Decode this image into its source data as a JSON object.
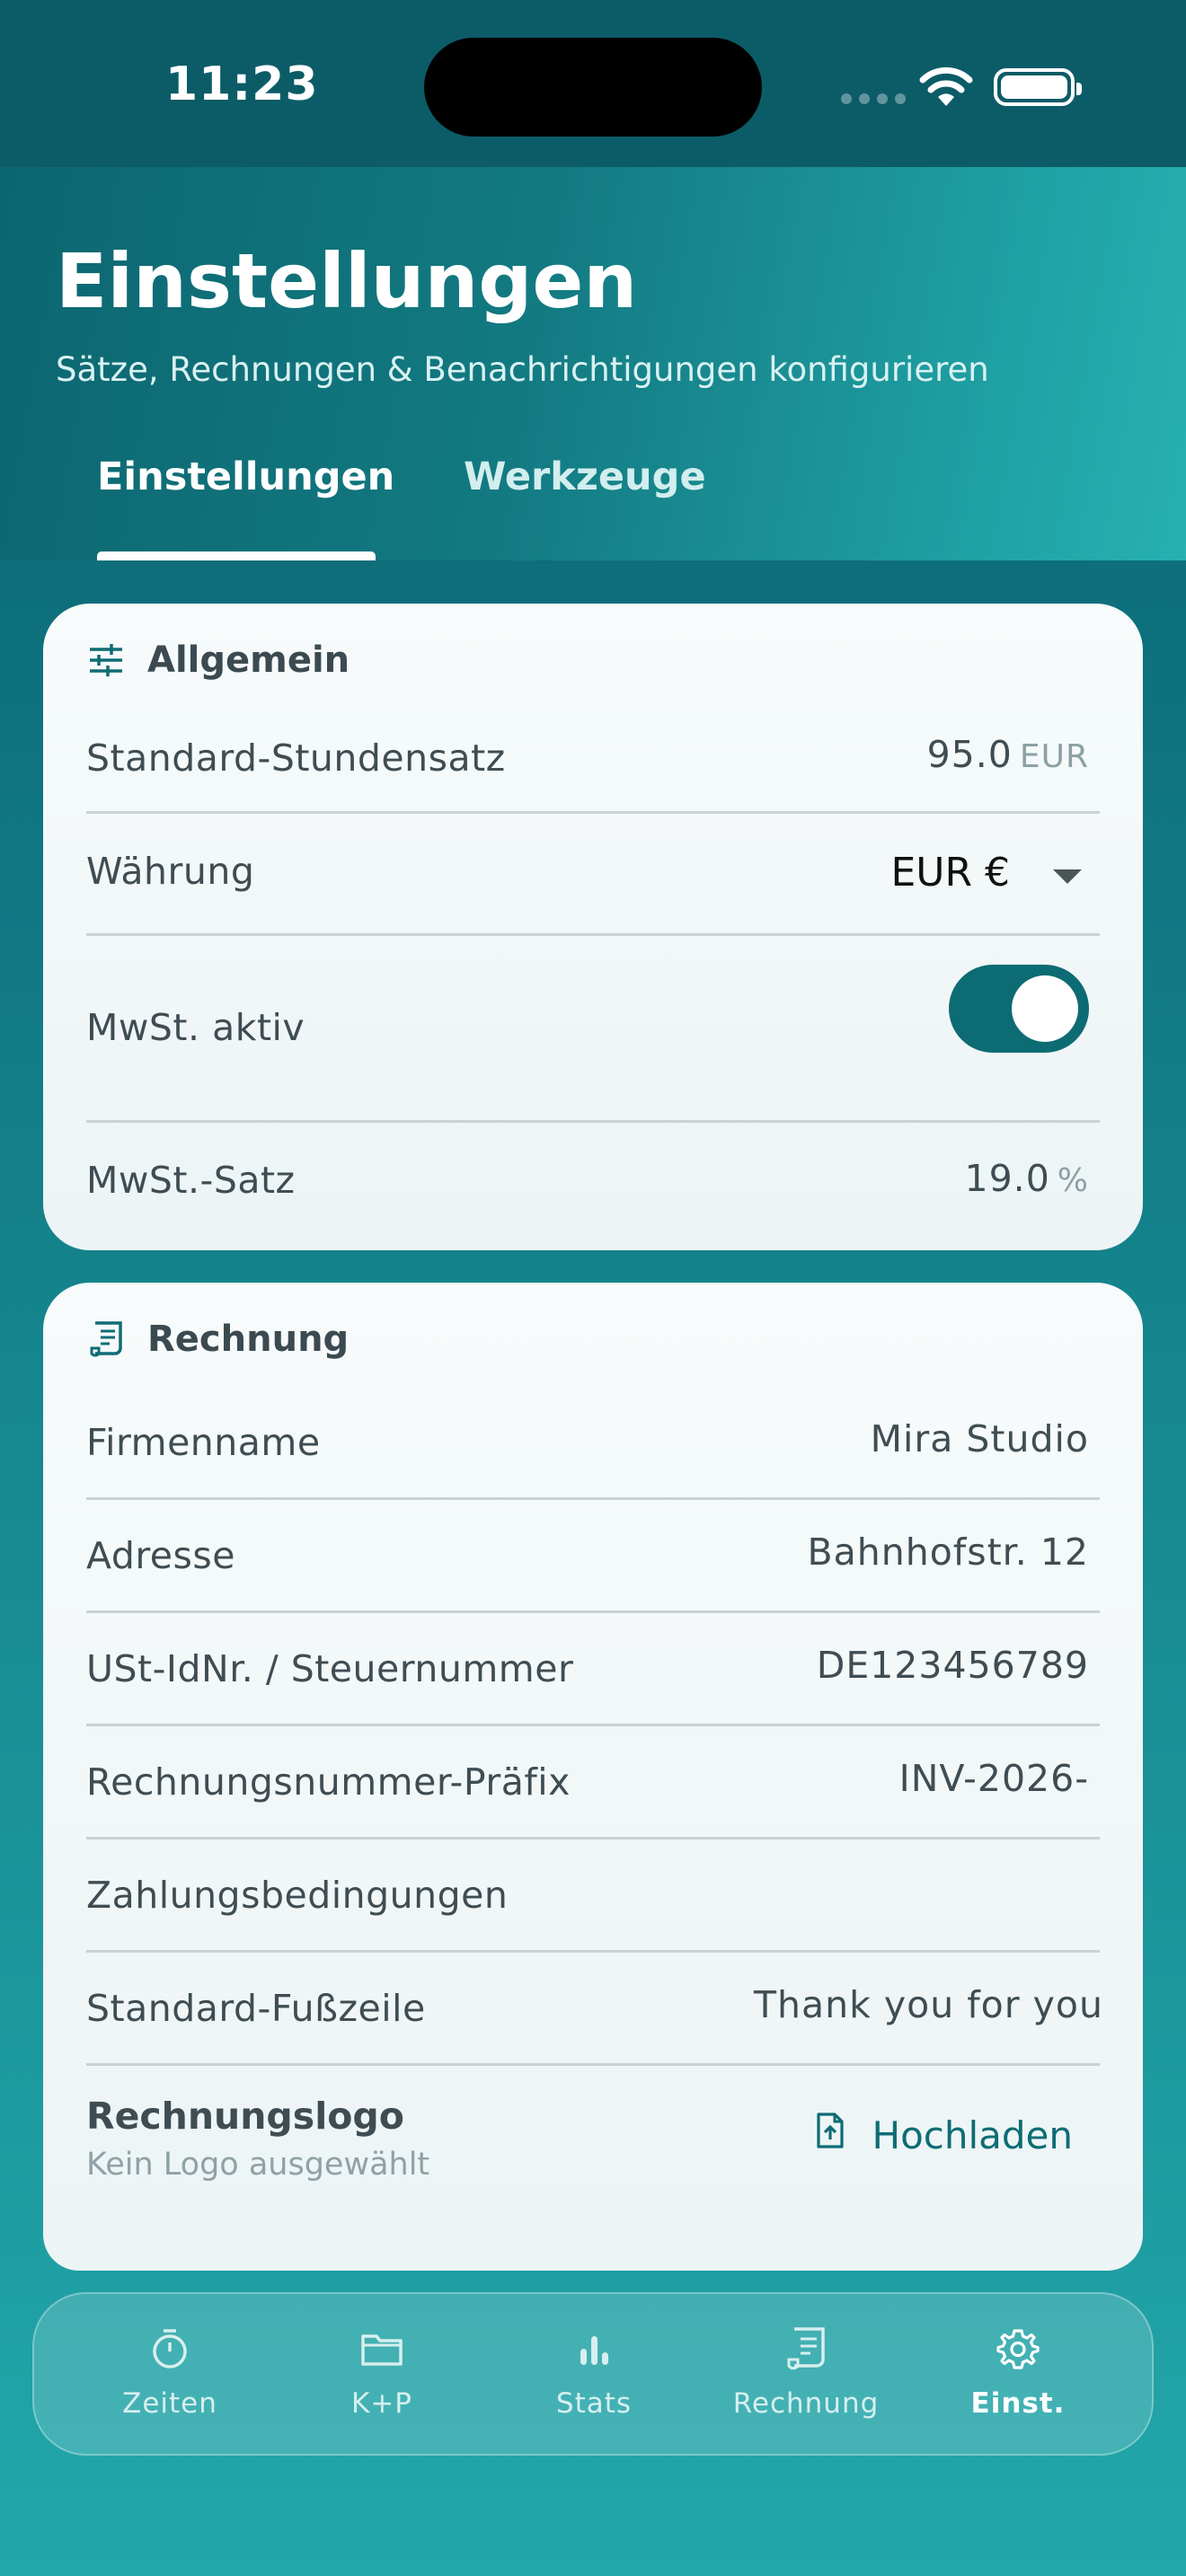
{
  "status_bar": {
    "time": "11:23",
    "icons": [
      "signal-icon",
      "wifi-icon",
      "battery-icon"
    ]
  },
  "header": {
    "title": "Einstellungen",
    "subtitle": "Sätze, Rechnungen & Benachrichtigungen konfigurieren",
    "tabs": [
      {
        "label": "Einstellungen",
        "active": true
      },
      {
        "label": "Werkzeuge",
        "active": false
      }
    ]
  },
  "general": {
    "title": "Allgemein",
    "icon": "sliders-icon",
    "hourly_rate": {
      "label": "Standard-Stundensatz",
      "value": "95.0",
      "unit": "EUR"
    },
    "currency": {
      "label": "Währung",
      "value": "EUR €"
    },
    "vat_active": {
      "label": "MwSt. aktiv",
      "on": true
    },
    "vat_rate": {
      "label": "MwSt.-Satz",
      "value": "19.0",
      "unit": "%"
    }
  },
  "invoice": {
    "title": "Rechnung",
    "icon": "receipt-icon",
    "rows": [
      {
        "label": "Firmenname",
        "value": "Mira Studio"
      },
      {
        "label": "Adresse",
        "value": "Bahnhofstr. 12"
      },
      {
        "label": "USt-IdNr. / Steuernummer",
        "value": "DE123456789"
      },
      {
        "label": "Rechnungsnummer-Präfix",
        "value": "INV-2026-"
      },
      {
        "label": "Zahlungsbedingungen",
        "value": ""
      },
      {
        "label": "Standard-Fußzeile",
        "value": "Thank you for you"
      }
    ],
    "logo": {
      "label": "Rechnungslogo",
      "sub": "Kein Logo ausgewählt",
      "button": "Hochladen"
    }
  },
  "bottom_nav": [
    {
      "label": "Zeiten",
      "icon": "stopwatch-icon",
      "active": false
    },
    {
      "label": "K+P",
      "icon": "folder-icon",
      "active": false
    },
    {
      "label": "Stats",
      "icon": "bar-chart-icon",
      "active": false
    },
    {
      "label": "Rechnung",
      "icon": "receipt-icon",
      "active": false
    },
    {
      "label": "Einst.",
      "icon": "gear-icon",
      "active": true
    }
  ],
  "colors": {
    "accent": "#0d6b73",
    "header_start": "#0c6670",
    "header_end": "#27b1b1"
  }
}
